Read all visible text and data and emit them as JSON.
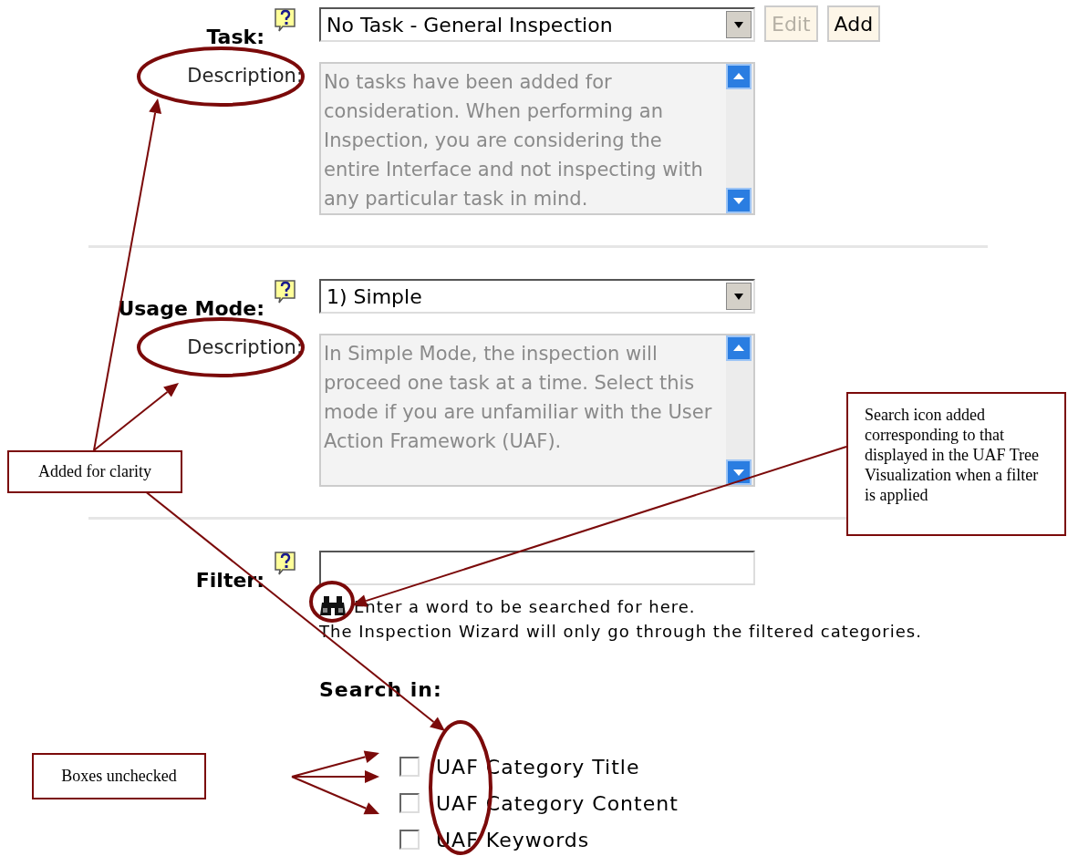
{
  "fields": [
    {
      "label": "Task:",
      "value": "No Task - General Inspection",
      "buttons": [
        {
          "label": "Edit",
          "disabled": true
        },
        {
          "label": "Add",
          "disabled": false
        }
      ],
      "description_label": "Description:",
      "description": "No tasks have been added for consideration. When performing an Inspection, you are considering the entire Interface and not inspecting with any particular task in mind."
    },
    {
      "label": "Usage Mode:",
      "value": "1) Simple",
      "description_label": "Description:",
      "description": "In Simple Mode, the inspection will proceed one task at a time. Select this mode if you are unfamiliar with the User Action Framework (UAF)."
    }
  ],
  "filter": {
    "label": "Filter:",
    "hint_lines": [
      "Enter a word to be searched for here.",
      "The Inspection Wizard will only go through the filtered categories."
    ]
  },
  "search_in": {
    "title": "Search in:",
    "options": [
      {
        "label": "UAF Category Title",
        "checked": false
      },
      {
        "label": "UAF Category Content",
        "checked": false
      },
      {
        "label": "UAF Keywords",
        "checked": false
      }
    ]
  },
  "annotations": [
    {
      "text": "Added for clarity"
    },
    {
      "text": "Search icon added corresponding to that displayed in the UAF Tree Visualization when a filter is applied"
    },
    {
      "text": "Boxes unchecked"
    }
  ]
}
